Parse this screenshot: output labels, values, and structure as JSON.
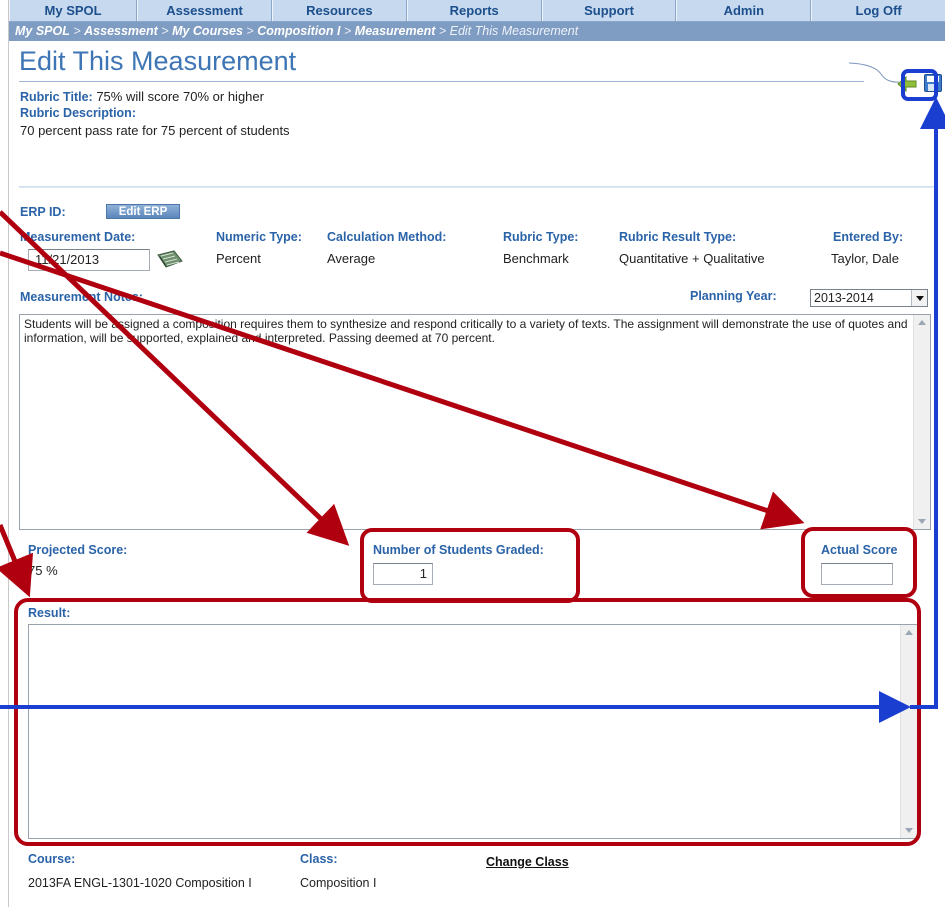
{
  "nav": {
    "items": [
      "My SPOL",
      "Assessment",
      "Resources",
      "Reports",
      "Support",
      "Admin",
      "Log Off"
    ]
  },
  "breadcrumb": {
    "items": [
      "My SPOL",
      "Assessment",
      "My Courses",
      "Composition I",
      "Measurement"
    ],
    "separator": ">",
    "current": "Edit This Measurement"
  },
  "page": {
    "title": "Edit This Measurement"
  },
  "rubric": {
    "title_label": "Rubric Title:",
    "title_value": "75% will score 70% or higher",
    "description_label": "Rubric Description:",
    "description_value": "70 percent pass rate for 75 percent of students"
  },
  "erp": {
    "label": "ERP ID:",
    "button": "Edit ERP"
  },
  "measurement": {
    "date_label": "Measurement Date:",
    "date_value": "11/21/2013",
    "numeric_type_label": "Numeric Type:",
    "numeric_type_value": "Percent",
    "calc_method_label": "Calculation Method:",
    "calc_method_value": "Average",
    "rubric_type_label": "Rubric Type:",
    "rubric_type_value": "Benchmark",
    "result_type_label": "Rubric Result Type:",
    "result_type_value": "Quantitative + Qualitative",
    "entered_by_label": "Entered By:",
    "entered_by_value": "Taylor, Dale",
    "notes_label": "Measurement Notes:",
    "notes_text": "Students will be assigned a composition requires them to synthesize and respond critically to a variety of texts. The assignment will demonstrate the use of quotes and information, will be supported, explained and interpreted. Passing deemed at 70 percent.",
    "planning_year_label": "Planning Year:",
    "planning_year_value": "2013-2014"
  },
  "scores": {
    "projected_label": "Projected Score:",
    "projected_value": "75 %",
    "students_graded_label": "Number of Students Graded:",
    "students_graded_value": "1",
    "actual_label": "Actual Score",
    "actual_value": ""
  },
  "result": {
    "label": "Result:",
    "text": ""
  },
  "course": {
    "course_label": "Course:",
    "course_value": "2013FA ENGL-1301-1020 Composition I",
    "class_label": "Class:",
    "class_value": "Composition I",
    "change_class": "Change Class"
  },
  "colors": {
    "label_blue": "#2a63a8",
    "title_blue": "#3e76b5",
    "annotation_red": "#b00010",
    "annotation_blue": "#1a3fd0"
  }
}
